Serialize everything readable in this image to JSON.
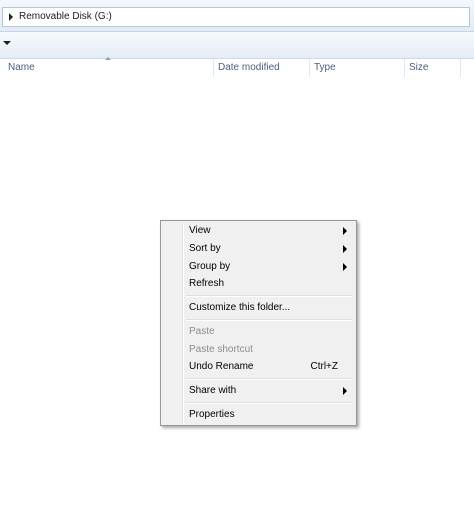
{
  "address": {
    "location": "Removable Disk (G:)"
  },
  "columns": [
    {
      "label": "Name"
    },
    {
      "label": "Date modified"
    },
    {
      "label": "Type"
    },
    {
      "label": "Size"
    }
  ],
  "context_menu": {
    "items": [
      {
        "label": "View",
        "submenu": true,
        "enabled": true
      },
      {
        "label": "Sort by",
        "submenu": true,
        "enabled": true
      },
      {
        "label": "Group by",
        "submenu": true,
        "enabled": true
      },
      {
        "label": "Refresh",
        "submenu": false,
        "enabled": true
      },
      {
        "label": "Customize this folder...",
        "submenu": false,
        "enabled": true
      },
      {
        "label": "Paste",
        "submenu": false,
        "enabled": false
      },
      {
        "label": "Paste shortcut",
        "submenu": false,
        "enabled": false
      },
      {
        "label": "Undo Rename",
        "shortcut": "Ctrl+Z",
        "submenu": false,
        "enabled": true
      },
      {
        "label": "Share with",
        "submenu": true,
        "enabled": true
      },
      {
        "label": "Properties",
        "submenu": false,
        "enabled": true
      }
    ]
  }
}
